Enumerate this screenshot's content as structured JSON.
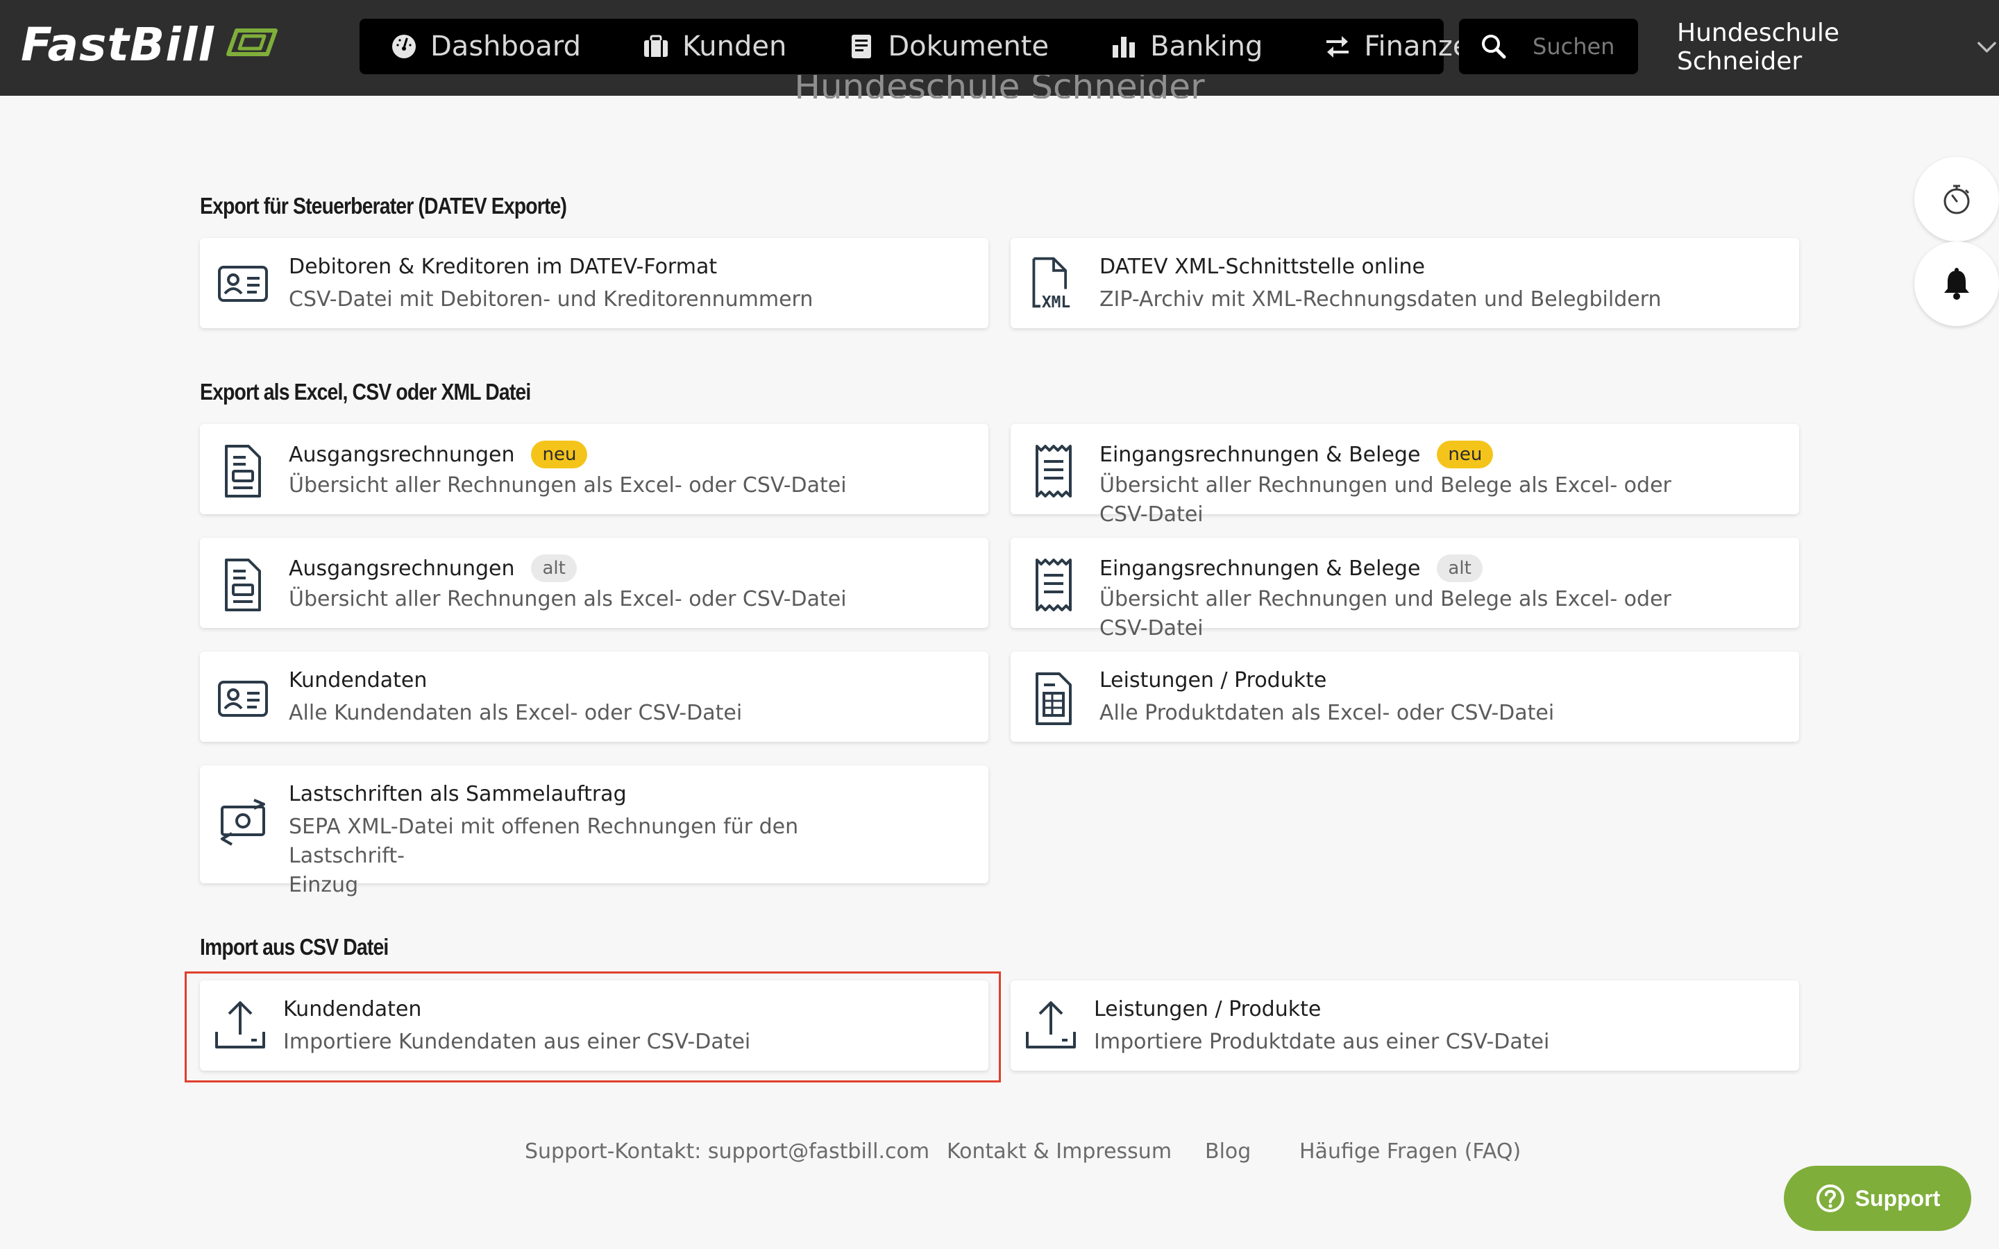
{
  "app": {
    "logo_text": "FastBill",
    "accent": "#7fae3a"
  },
  "nav": {
    "items": [
      {
        "label": "Dashboard",
        "icon": "gauge-icon"
      },
      {
        "label": "Kunden",
        "icon": "briefcase-icon"
      },
      {
        "label": "Dokumente",
        "icon": "document-icon"
      },
      {
        "label": "Banking",
        "icon": "bar-chart-icon"
      },
      {
        "label": "Finanzen",
        "icon": "transfer-arrows-icon"
      }
    ],
    "search_placeholder": "Suchen",
    "account_name": "Hundeschule Schneider"
  },
  "page": {
    "ghost_title": "Hundeschule Schneider"
  },
  "sections": [
    {
      "title": "Export für Steuerberater (DATEV Exporte)",
      "cards": [
        {
          "title": "Debitoren & Kreditoren im DATEV-Format",
          "subtitle": "CSV-Datei mit Debitoren- und Kreditorennummern",
          "icon": "contact-card-icon"
        },
        {
          "title": "DATEV XML-Schnittstelle online",
          "subtitle": "ZIP-Archiv mit XML-Rechnungsdaten und Belegbildern",
          "icon": "xml-file-icon",
          "icon_text": "XML"
        }
      ]
    },
    {
      "title": "Export als Excel, CSV oder XML Datei",
      "cards": [
        {
          "title": "Ausgangsrechnungen",
          "badge": "neu",
          "subtitle": "Übersicht aller Rechnungen als Excel- oder CSV-Datei",
          "icon": "invoice-icon"
        },
        {
          "title": "Eingangsrechnungen & Belege",
          "badge": "neu",
          "subtitle": "Übersicht aller Rechnungen und Belege als Excel- oder CSV-Datei",
          "icon": "receipt-icon"
        },
        {
          "title": "Ausgangsrechnungen",
          "badge": "alt",
          "subtitle": "Übersicht aller Rechnungen als Excel- oder CSV-Datei",
          "icon": "invoice-icon"
        },
        {
          "title": "Eingangsrechnungen & Belege",
          "badge": "alt",
          "subtitle": "Übersicht aller Rechnungen und Belege als Excel- oder CSV-Datei",
          "icon": "receipt-icon"
        },
        {
          "title": "Kundendaten",
          "subtitle": "Alle Kundendaten als Excel- oder CSV-Datei",
          "icon": "contact-card-icon"
        },
        {
          "title": "Leistungen / Produkte",
          "subtitle": "Alle Produktdaten als Excel- oder CSV-Datei",
          "icon": "spreadsheet-file-icon"
        },
        {
          "title": "Lastschriften als Sammelauftrag",
          "subtitle_line1": "SEPA XML-Datei mit offenen Rechnungen für den Lastschrift-",
          "subtitle_line2": "Einzug",
          "icon": "money-transfer-icon"
        }
      ]
    },
    {
      "title": "Import aus CSV Datei",
      "cards": [
        {
          "title": "Kundendaten",
          "subtitle": "Importiere Kundendaten aus einer CSV-Datei",
          "icon": "upload-icon"
        },
        {
          "title": "Leistungen / Produkte",
          "subtitle": "Importiere Produktdate aus einer CSV-Datei",
          "icon": "upload-icon"
        }
      ]
    }
  ],
  "footer": {
    "support_contact": "Support-Kontakt: support@fastbill.com",
    "contact": "Kontakt & Impressum",
    "blog": "Blog",
    "faq": "Häufige Fragen (FAQ)"
  },
  "support_button": "Support"
}
